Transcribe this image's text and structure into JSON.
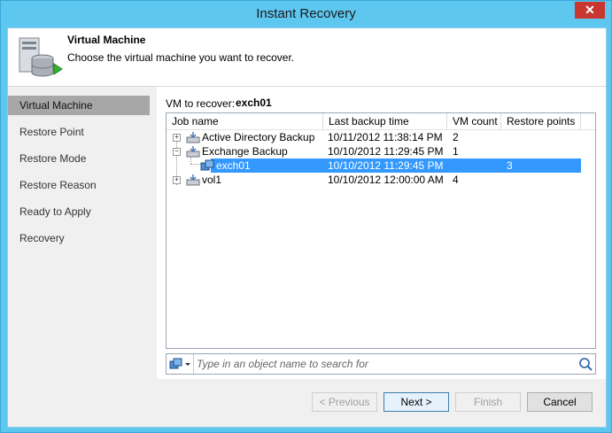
{
  "window": {
    "title": "Instant Recovery",
    "close_glyph": "✕"
  },
  "header": {
    "title": "Virtual Machine",
    "description": "Choose the virtual machine you want to recover.",
    "icon": "server-database-icon"
  },
  "nav": {
    "items": [
      {
        "label": "Virtual Machine",
        "active": true
      },
      {
        "label": "Restore Point"
      },
      {
        "label": "Restore Mode"
      },
      {
        "label": "Restore Reason"
      },
      {
        "label": "Ready to Apply"
      },
      {
        "label": "Recovery"
      }
    ]
  },
  "vm": {
    "label": "VM to recover:",
    "value": "exch01"
  },
  "grid": {
    "columns": [
      "Job name",
      "Last backup time",
      "VM count",
      "Restore points"
    ],
    "rows": [
      {
        "name": "Active Directory Backup",
        "time": "10/11/2012 11:38:14 PM",
        "vm_count": "2",
        "restore_points": "",
        "expander": "+"
      },
      {
        "name": "Exchange Backup",
        "time": "10/10/2012 11:29:45 PM",
        "vm_count": "1",
        "restore_points": "",
        "expander": "−"
      },
      {
        "name": "exch01",
        "time": "10/10/2012 11:29:45 PM",
        "vm_count": "",
        "restore_points": "3",
        "selected": true
      },
      {
        "name": "vol1",
        "time": "10/10/2012 12:00:00 AM",
        "vm_count": "4",
        "restore_points": "",
        "expander": "+"
      }
    ]
  },
  "search": {
    "placeholder": "Type in an object name to search for"
  },
  "buttons": {
    "previous": "< Previous",
    "next": "Next >",
    "finish": "Finish",
    "cancel": "Cancel"
  },
  "colors": {
    "titlebar": "#5ec7f0",
    "selection": "#3399ff",
    "nav_active": "#a7a7a7",
    "close": "#c7372f"
  }
}
